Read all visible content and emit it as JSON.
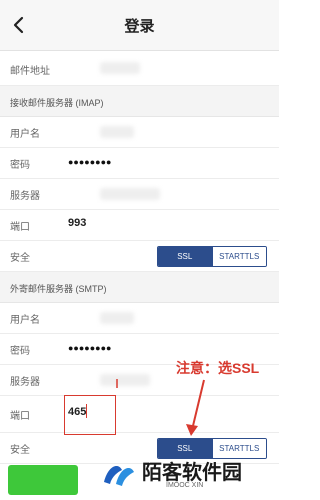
{
  "navbar": {
    "title": "登录",
    "back_icon": "chevron-left-icon"
  },
  "email": {
    "label": "邮件地址"
  },
  "imap": {
    "section_title": "接收邮件服务器 (IMAP)",
    "username_label": "用户名",
    "password_label": "密码",
    "password_value": "●●●●●●●●",
    "server_label": "服务器",
    "port_label": "端口",
    "port_value": "993",
    "security_label": "安全",
    "security_options": [
      "SSL",
      "STARTTLS"
    ],
    "security_selected": "SSL"
  },
  "smtp": {
    "section_title": "外寄邮件服务器 (SMTP)",
    "username_label": "用户名",
    "password_label": "密码",
    "password_value": "●●●●●●●●",
    "server_label": "服务器",
    "port_label": "端口",
    "port_value": "465",
    "security_label": "安全",
    "security_options": [
      "SSL",
      "STARTTLS"
    ],
    "security_selected": "SSL"
  },
  "annotation": {
    "text": "注意：选SSL",
    "color": "#d83a2f"
  },
  "watermark": {
    "text": "陌客软件园",
    "sub": "IMOOC XIN"
  },
  "colors": {
    "accent": "#2c4d8c",
    "green": "#3ec83a"
  }
}
